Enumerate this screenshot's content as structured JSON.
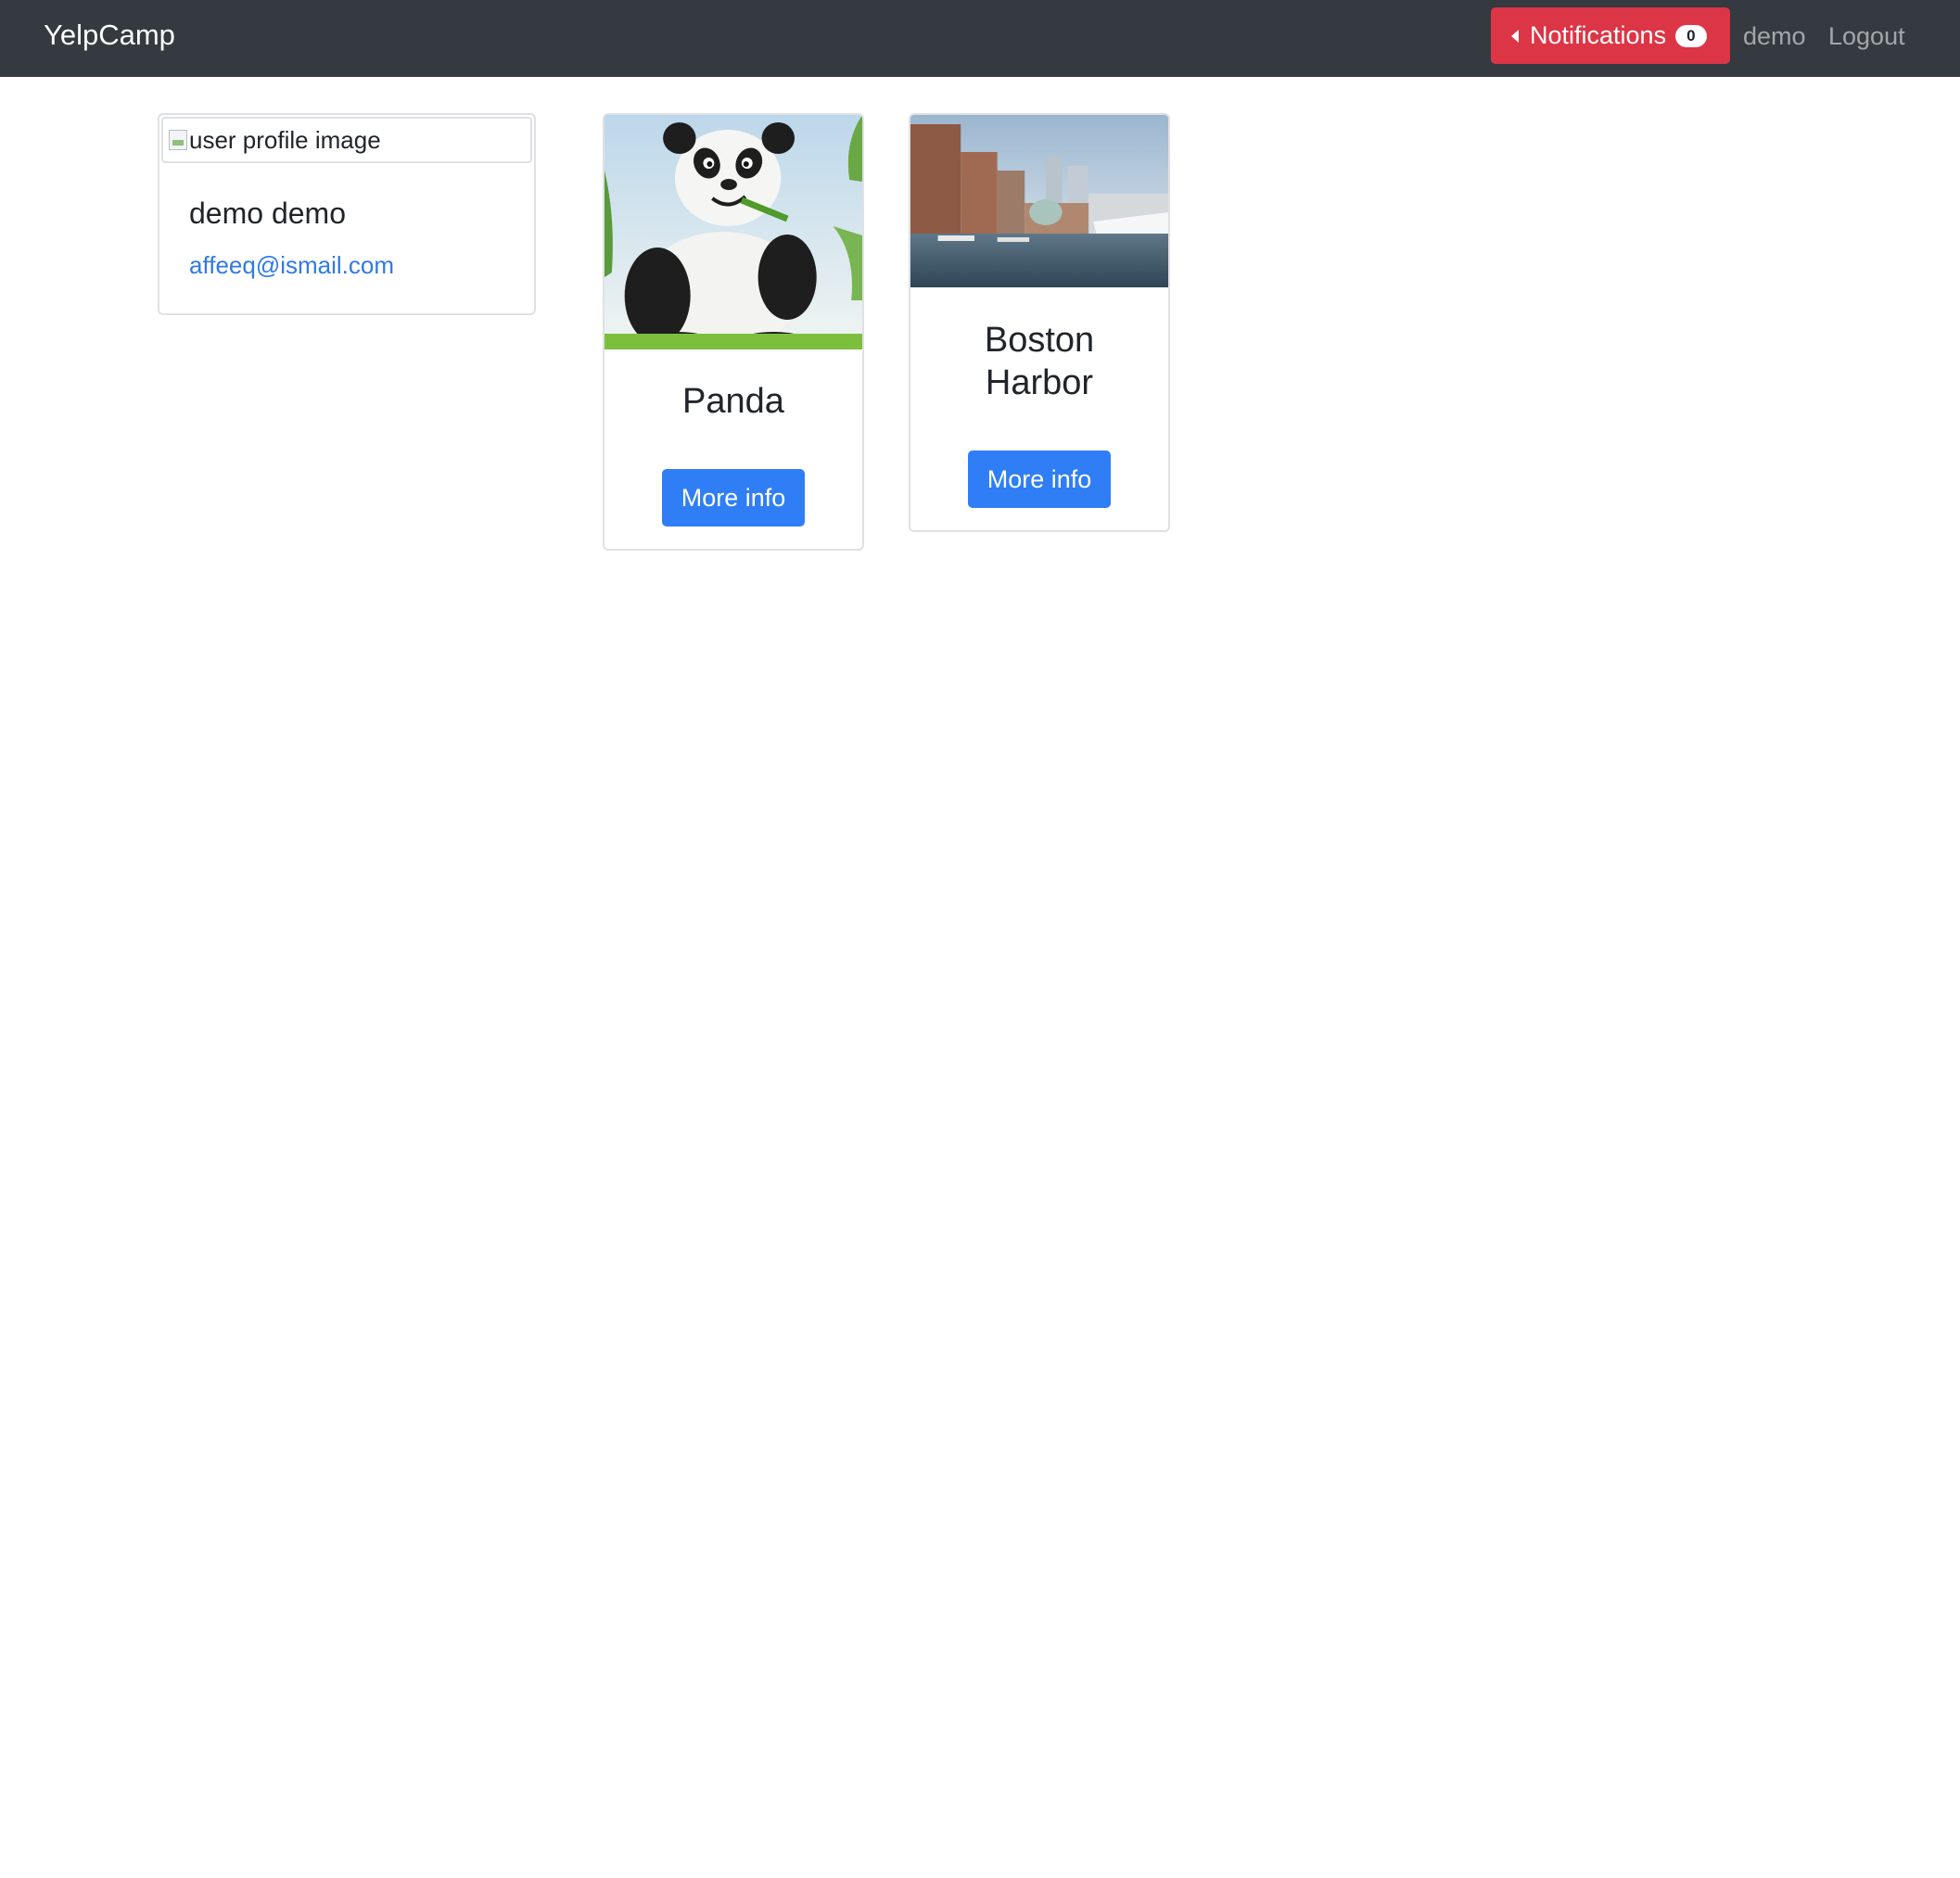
{
  "navbar": {
    "brand": "YelpCamp",
    "notifications_label": "Notifications",
    "notifications_count": "0",
    "user_link": "demo",
    "logout_link": "Logout"
  },
  "profile": {
    "image_alt": "user profile image",
    "name": "demo demo",
    "email": "affeeq@ismail.com"
  },
  "campgrounds": [
    {
      "name": "Panda",
      "button_label": "More info",
      "image": "panda-photo"
    },
    {
      "name": "Boston Harbor",
      "button_label": "More info",
      "image": "boston-harbor-photo"
    }
  ],
  "colors": {
    "navbar_bg": "#343a40",
    "notifications_bg": "#dc3545",
    "primary_button": "#2f7ef6",
    "link": "#2f7ae5"
  }
}
